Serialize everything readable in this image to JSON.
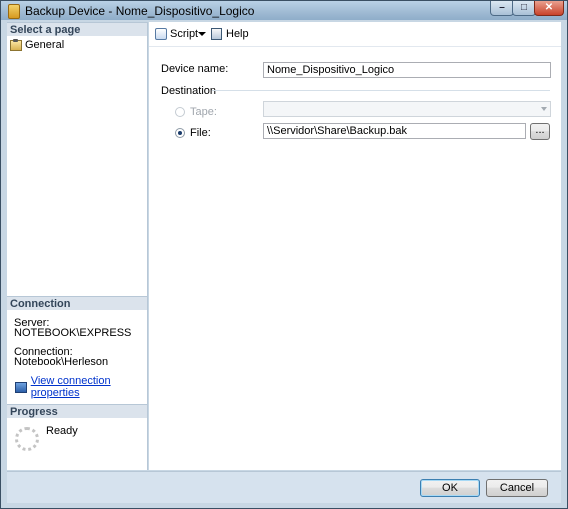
{
  "window": {
    "title": "Backup Device - Nome_Dispositivo_Logico",
    "controls": [
      "minimize",
      "maximize",
      "close"
    ]
  },
  "left_panel": {
    "select_page_header": "Select a page",
    "pages": [
      {
        "label": "General",
        "icon": "general-page-icon"
      }
    ],
    "connection": {
      "header": "Connection",
      "server_label": "Server:",
      "server_value": "NOTEBOOK\\EXPRESS",
      "connection_label": "Connection:",
      "connection_value": "Notebook\\Herleson",
      "view_link": "View connection properties"
    },
    "progress": {
      "header": "Progress",
      "status": "Ready"
    }
  },
  "toolbar": {
    "script_label": "Script",
    "help_label": "Help"
  },
  "form": {
    "device_name_label": "Device name:",
    "device_name_value": "Nome_Dispositivo_Logico",
    "destination_label": "Destination",
    "tape_label": "Tape:",
    "tape_value": "",
    "file_label": "File:",
    "file_value": "\\\\Servidor\\Share\\Backup.bak",
    "browse_label": "...",
    "selected_destination": "File"
  },
  "buttons": {
    "ok": "OK",
    "cancel": "Cancel"
  },
  "colors": {
    "accent": "#3c7fb1",
    "link": "#0033cc",
    "panel_header": "#dbe3ec"
  }
}
